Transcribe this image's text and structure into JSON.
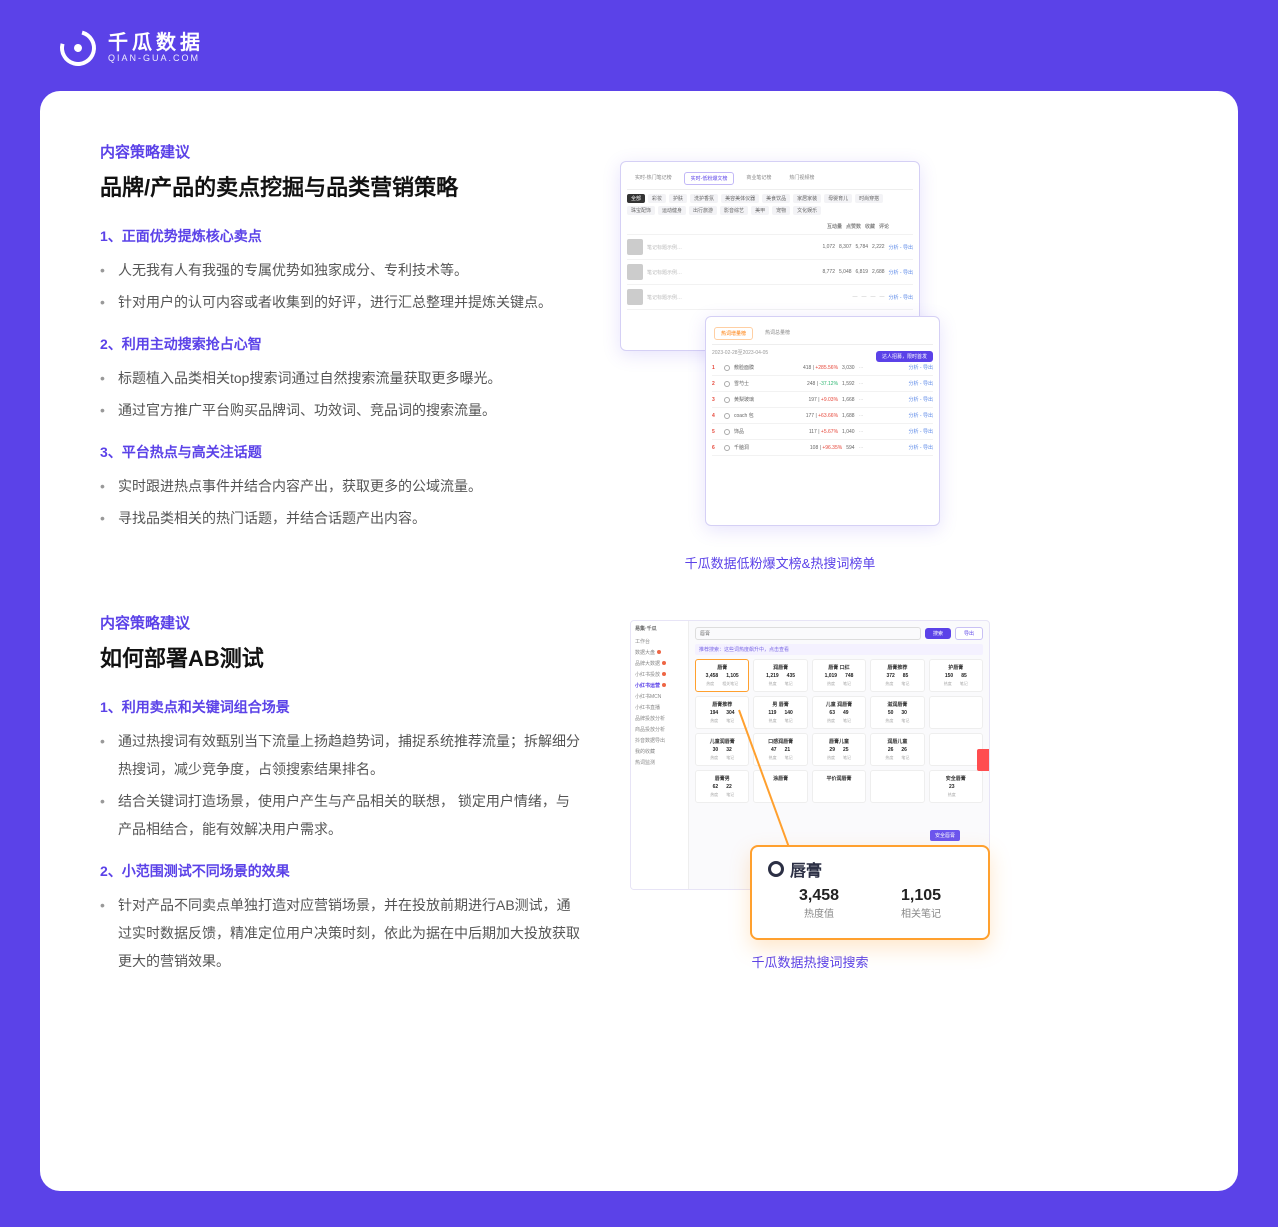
{
  "brand": {
    "cn": "千瓜数据",
    "en": "QIAN-GUA.COM"
  },
  "sec1": {
    "eyebrow": "内容策略建议",
    "title": "品牌/产品的卖点挖掘与品类营销策略",
    "h1": "1、正面优势提炼核心卖点",
    "b1a": "人无我有人有我强的专属优势如独家成分、专利技术等。",
    "b1b": "针对用户的认可内容或者收集到的好评，进行汇总整理并提炼关键点。",
    "h2": "2、利用主动搜索抢占心智",
    "b2a": "标题植入品类相关top搜索词通过自然搜索流量获取更多曝光。",
    "b2b": "通过官方推广平台购买品牌词、功效词、竞品词的搜索流量。",
    "h3": "3、平台热点与高关注话题",
    "b3a": "实时跟进热点事件并结合内容产出，获取更多的公域流量。",
    "b3b": "寻找品类相关的热门话题，并结合话题产出内容。",
    "caption": "千瓜数据低粉爆文榜&热搜词榜单"
  },
  "shot1": {
    "tab1": "实时-热门笔记榜",
    "tab2": "实时-低粉爆文榜",
    "tab3": "商业笔记榜",
    "tab4": "热门视频榜",
    "chip_all": "全部",
    "chips": [
      "彩妆",
      "护肤",
      "洗护香氛",
      "美容美体仪器",
      "美食饮品",
      "家居家装",
      "母婴育儿",
      "时尚穿搭",
      "珠宝配饰",
      "运动健身",
      "出行旅游",
      "影音综艺",
      "美甲",
      "宠物",
      "文化娱乐"
    ],
    "col_a": "互动量",
    "col_b": "点赞数",
    "col_c": "收藏",
    "col_d": "评论",
    "link": "分析 - 导出",
    "sub_tab_a": "热词增量榜",
    "sub_tab_b": "热词总量榜",
    "daterange": "2023-02-28至2023-04-05",
    "pill": "达人招募，限时首发",
    "rows": [
      {
        "rank": "1",
        "name": "敷脸面膜",
        "v": "418",
        "t": "+285.56%",
        "n": "3,030"
      },
      {
        "rank": "2",
        "name": "雪芍士",
        "v": "248",
        "t": "-37.12%",
        "n": "1,592"
      },
      {
        "rank": "3",
        "name": "黄梨玻璃",
        "v": "197",
        "t": "+9.03%",
        "n": "1,668"
      },
      {
        "rank": "4",
        "name": "coach 包",
        "v": "177",
        "t": "+63.66%",
        "n": "1,688"
      },
      {
        "rank": "5",
        "name": "饰品",
        "v": "117",
        "t": "+5.67%",
        "n": "1,040"
      },
      {
        "rank": "6",
        "name": "千脑洞",
        "v": "108",
        "t": "+96.35%",
        "n": "594"
      }
    ]
  },
  "sec2": {
    "eyebrow": "内容策略建议",
    "title": "如何部署AB测试",
    "h1": "1、利用卖点和关键词组合场景",
    "b1a": "通过热搜词有效甄别当下流量上扬趋趋势词，捕捉系统推荐流量；拆解细分热搜词，减少竞争度，占领搜索结果排名。",
    "b1b": "结合关键词打造场景，使用户产生与产品相关的联想，  锁定用户情绪，与产品相结合，能有效解决用户需求。",
    "h2": "2、小范围测试不同场景的效果",
    "b2a": "针对产品不同卖点单独打造对应营销场景，并在投放前期进行AB测试，通过实时数据反馈，精准定位用户决策时刻，依此为据在中后期加大投放获取更大的营销效果。",
    "caption": "千瓜数据热搜词搜索"
  },
  "shot2": {
    "brand": "易集·千瓜",
    "side": [
      "工作台",
      "数据大盘",
      "品牌大数据",
      "小红书投放",
      "小红书运营",
      "小红书MCN",
      "小红书直播",
      "品牌投放分析",
      "商品投放分析",
      "抖音数据导出",
      "我的收藏",
      "热词监测"
    ],
    "side_active": 4,
    "search_value": "唇膏",
    "btn_search": "搜索",
    "btn_more": "导出",
    "hint": "推荐搜索：这些词热度飙升中，点击查看",
    "cells": [
      {
        "n": "唇膏",
        "a": "3,458",
        "b": "1,105",
        "al": "热度",
        "bl": "相关笔记"
      },
      {
        "n": "润唇膏",
        "a": "1,219",
        "b": "435"
      },
      {
        "n": "唇膏 口红",
        "a": "1,019",
        "b": "748"
      },
      {
        "n": "唇膏推荐",
        "a": "372",
        "b": "85"
      },
      {
        "n": "护唇膏",
        "a": "150",
        "b": "85"
      },
      {
        "n": "唇膏推荐",
        "a": "194",
        "b": "304"
      },
      {
        "n": "男 唇膏",
        "a": "119",
        "b": "140"
      },
      {
        "n": "儿童 润唇膏",
        "a": "63",
        "b": "49"
      },
      {
        "n": "滋润唇膏",
        "a": "50",
        "b": "30"
      },
      {
        "n": "",
        "a": "",
        "b": ""
      },
      {
        "n": "儿童润唇膏",
        "a": "30",
        "b": "32"
      },
      {
        "n": "口感润唇膏",
        "a": "47",
        "b": "21"
      },
      {
        "n": "唇膏儿童",
        "a": "29",
        "b": "25"
      },
      {
        "n": "润唇儿童",
        "a": "26",
        "b": "26"
      },
      {
        "n": "",
        "a": "",
        "b": ""
      },
      {
        "n": "唇膏男",
        "a": "62",
        "b": "22"
      },
      {
        "n": "涂唇膏",
        "a": "",
        "b": ""
      },
      {
        "n": "平价润唇膏",
        "a": "",
        "b": ""
      },
      {
        "n": "",
        "a": "",
        "b": ""
      },
      {
        "n": "安全唇膏",
        "a": "23",
        "b": ""
      }
    ],
    "callout_title": "唇膏",
    "callout_a": "3,458",
    "callout_al": "热度值",
    "callout_b": "1,105",
    "callout_bl": "相关笔记",
    "purple_tag": "安全唇膏"
  }
}
